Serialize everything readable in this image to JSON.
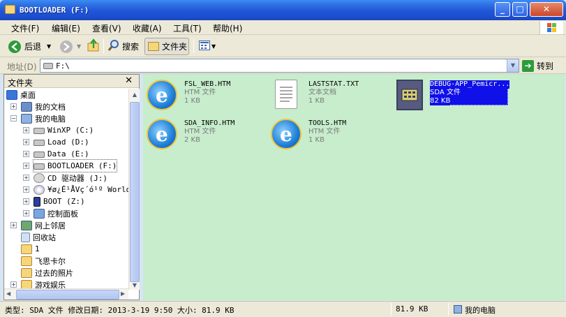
{
  "window": {
    "title": "BOOTLOADER (F:)"
  },
  "menu": [
    "文件(F)",
    "编辑(E)",
    "查看(V)",
    "收藏(A)",
    "工具(T)",
    "帮助(H)"
  ],
  "toolbar": {
    "back": "后退",
    "search": "搜索",
    "folders": "文件夹"
  },
  "address": {
    "label": "地址(D)",
    "value": "F:\\",
    "go": "转到"
  },
  "folder_pane": {
    "title": "文件夹",
    "items": [
      {
        "label": "桌面",
        "icon": "desktop-icon"
      },
      {
        "label": "我的文档",
        "icon": "my-documents-icon"
      },
      {
        "label": "我的电脑",
        "icon": "my-computer-icon"
      },
      {
        "label": "WinXP (C:)",
        "icon": "drive-icon"
      },
      {
        "label": "Load (D:)",
        "icon": "drive-icon"
      },
      {
        "label": "Data (E:)",
        "icon": "drive-icon"
      },
      {
        "label": "BOOTLOADER (F:)",
        "icon": "drive-icon"
      },
      {
        "label": "CD 驱动器 (J:)",
        "icon": "cd-drive-icon"
      },
      {
        "label": "¥ø¿É¹ÅVç´ó¹º World",
        "icon": "cd-drive-icon"
      },
      {
        "label": "BOOT (Z:)",
        "icon": "removable-drive-icon"
      },
      {
        "label": "控制面板",
        "icon": "control-panel-icon"
      },
      {
        "label": "网上邻居",
        "icon": "network-icon"
      },
      {
        "label": "回收站",
        "icon": "recycle-bin-icon"
      },
      {
        "label": "1",
        "icon": "folder-icon"
      },
      {
        "label": "飞思卡尔",
        "icon": "folder-icon"
      },
      {
        "label": "过去的照片",
        "icon": "folder-icon"
      },
      {
        "label": "游戏娱乐",
        "icon": "folder-icon"
      }
    ]
  },
  "files": [
    {
      "name": "FSL_WEB.HTM",
      "type": "HTM 文件",
      "size": "1 KB",
      "icon": "ie-document-icon"
    },
    {
      "name": "LASTSTAT.TXT",
      "type": "文本文档",
      "size": "1 KB",
      "icon": "text-document-icon"
    },
    {
      "name": "DEBUG-APP_Pemicr...",
      "type": "SDA 文件",
      "size": "82 KB",
      "icon": "sda-file-icon",
      "selected": true
    },
    {
      "name": "SDA_INFO.HTM",
      "type": "HTM 文件",
      "size": "2 KB",
      "icon": "ie-document-icon"
    },
    {
      "name": "TOOLS.HTM",
      "type": "HTM 文件",
      "size": "1 KB",
      "icon": "ie-document-icon"
    }
  ],
  "status": {
    "info": "类型: SDA 文件 修改日期: 2013-3-19 9:50 大小: 81.9 KB",
    "size": "81.9 KB",
    "location": "我的电脑"
  }
}
